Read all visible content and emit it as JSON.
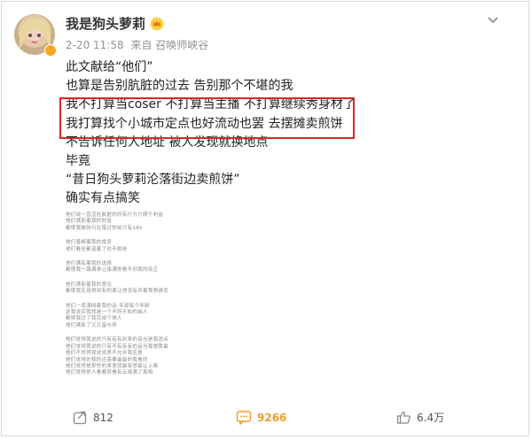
{
  "post": {
    "author": "我是狗头萝莉",
    "time": "2-20 11:58",
    "source": "来自 召唤师峡谷",
    "lines": [
      "此文献给“他们”",
      "也算是告别肮脏的过去 告别那个不堪的我",
      "我不打算当coser 不打算当主播 不打算继续秀身材了",
      "我打算找个小城市定点也好流动也罢 去摆摊卖煎饼",
      "不告诉任何人地址  被人发现就换地点",
      "毕竟",
      "“昔日狗头萝莉沦落街边卖煎饼”",
      "确实有点搞笑"
    ],
    "highlighted_lines": [
      2,
      3
    ],
    "doc_image_lines": [
      [
        "他们说一直活在肮脏的所有行为只顾于利益",
        "他们满影着我的财富",
        "都恨我被执行在错过你前只有180"
      ],
      [
        "他们善嫉着我的成员",
        "他们看全都道着了也不相信"
      ],
      [
        "他们满有着我的选择",
        "都恨我一路满来让接满你看不到我的改正"
      ],
      [
        "他们满影着我的意见",
        "都恨我应用得到有的面让他没有许着我想谁优"
      ],
      [
        "他们一道满网着我的话 专现每个年龄",
        "这我说实我找是一个不所不知的抽人",
        "都恨我过了我完成个快人",
        "他们满影了又又留与传"
      ],
      [
        "他们觉得我说的只有有有到来的话当是我消点",
        "他们觉得我说的只有不有有有的话当我想我最",
        "他们不觉得我说说表不允许我应是",
        "他们觉得的我的还需要最最的我看的",
        "他们觉得是那些的表意就最有想最让上都",
        "他们觉得他人看着就看有云成满了真相"
      ]
    ]
  },
  "actions": {
    "share_icon": "share-icon",
    "share_count": "812",
    "comment_icon": "comment-icon",
    "comment_count": "9266",
    "like_icon": "thumbs-up-icon",
    "like_count": "6.4万"
  },
  "colors": {
    "highlight_border": "#e02424",
    "comment_accent": "#f09d2a",
    "meta_text": "#939393"
  }
}
